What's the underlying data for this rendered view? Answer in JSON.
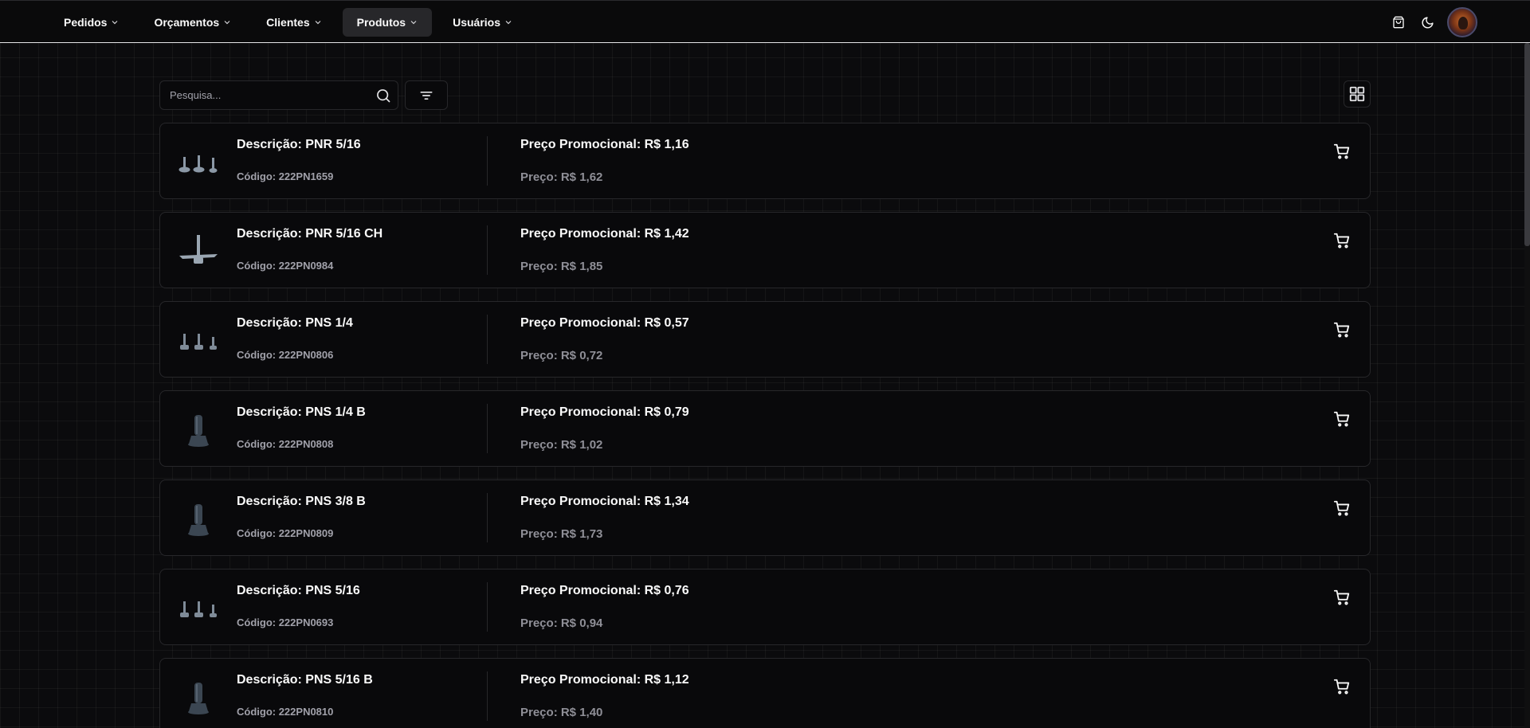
{
  "nav": {
    "items": [
      {
        "label": "Pedidos"
      },
      {
        "label": "Orçamentos"
      },
      {
        "label": "Clientes"
      },
      {
        "label": "Produtos",
        "active": true
      },
      {
        "label": "Usuários"
      }
    ]
  },
  "search": {
    "placeholder": "Pesquisa..."
  },
  "products": [
    {
      "description": "Descrição: PNR 5/16",
      "code": "Código: 222PN1659",
      "promo": "Preço Promocional: R$ 1,16",
      "price": "Preço: R$ 1,62",
      "thumb": "three-feet"
    },
    {
      "description": "Descrição: PNR 5/16 CH",
      "code": "Código: 222PN0984",
      "promo": "Preço Promocional: R$ 1,42",
      "price": "Preço: R$ 1,85",
      "thumb": "plate-foot"
    },
    {
      "description": "Descrição: PNS 1/4",
      "code": "Código: 222PN0806",
      "promo": "Preço Promocional: R$ 0,57",
      "price": "Preço: R$ 0,72",
      "thumb": "three-feet"
    },
    {
      "description": "Descrição: PNS 1/4 B",
      "code": "Código: 222PN0808",
      "promo": "Preço Promocional: R$ 0,79",
      "price": "Preço: R$ 1,02",
      "thumb": "boot-foot"
    },
    {
      "description": "Descrição: PNS 3/8 B",
      "code": "Código: 222PN0809",
      "promo": "Preço Promocional: R$ 1,34",
      "price": "Preço: R$ 1,73",
      "thumb": "boot-foot"
    },
    {
      "description": "Descrição: PNS 5/16",
      "code": "Código: 222PN0693",
      "promo": "Preço Promocional: R$ 0,76",
      "price": "Preço: R$ 0,94",
      "thumb": "three-feet"
    },
    {
      "description": "Descrição: PNS 5/16 B",
      "code": "Código: 222PN0810",
      "promo": "Preço Promocional: R$ 1,12",
      "price": "Preço: R$ 1,40",
      "thumb": "boot-foot"
    }
  ],
  "icons": {
    "cart": "shopping-cart-icon",
    "bag": "shopping-bag-icon",
    "theme": "moon-icon",
    "search": "search-icon",
    "filter": "filter-icon",
    "grid": "grid-view-icon"
  },
  "colors": {
    "background": "#0b0b0d",
    "card": "#09090b",
    "border": "#27272a",
    "muted": "#a1a1aa"
  }
}
